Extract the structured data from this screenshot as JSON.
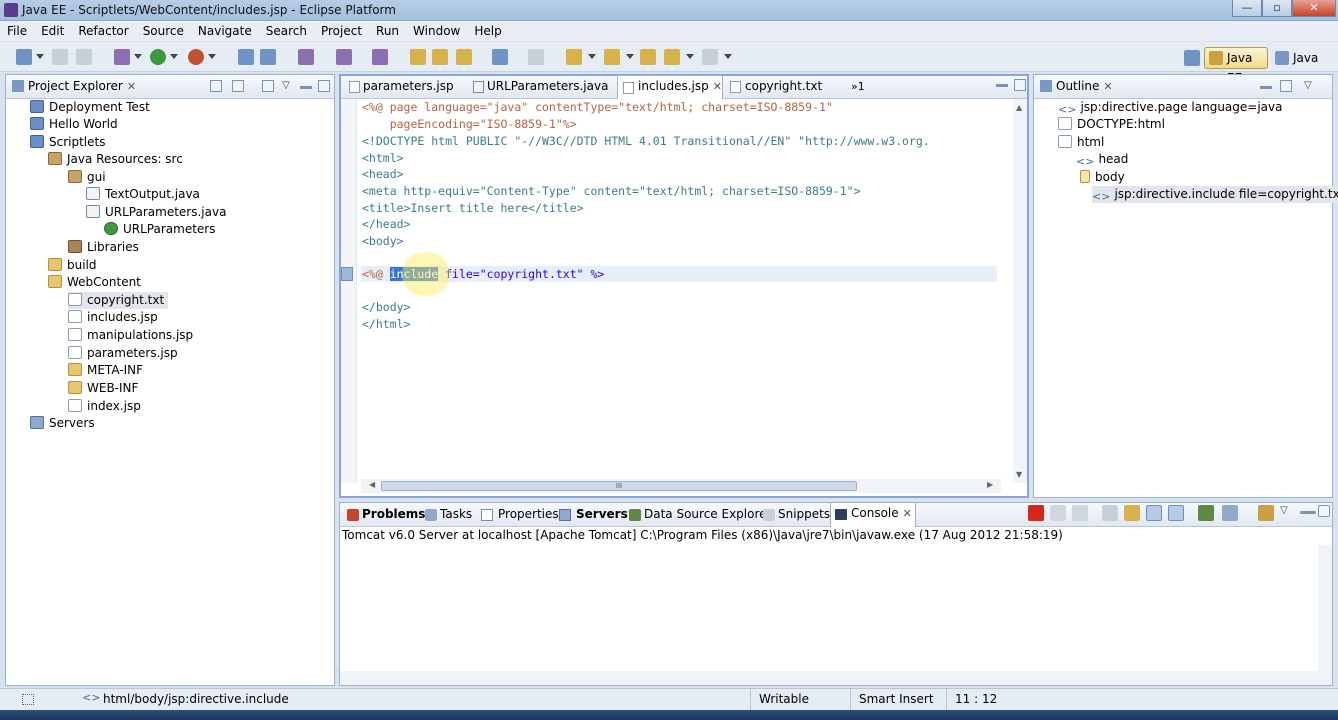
{
  "window": {
    "title": "Java EE - Scriptlets/WebContent/includes.jsp - Eclipse Platform",
    "min": "—",
    "max": "▫",
    "close": "✕"
  },
  "menu": [
    "File",
    "Edit",
    "Refactor",
    "Source",
    "Navigate",
    "Search",
    "Project",
    "Run",
    "Window",
    "Help"
  ],
  "perspectives": {
    "active": "Java EE",
    "other": "Java"
  },
  "project_explorer": {
    "title": "Project Explorer",
    "items": [
      {
        "label": "Deployment Test",
        "icon": "project-icon",
        "depth": 0
      },
      {
        "label": "Hello World",
        "icon": "project-icon",
        "depth": 0
      },
      {
        "label": "Scriptlets",
        "icon": "project-icon",
        "depth": 0
      },
      {
        "label": "Java Resources: src",
        "icon": "source-folder-icon",
        "depth": 1
      },
      {
        "label": "gui",
        "icon": "package-icon",
        "depth": 2
      },
      {
        "label": "TextOutput.java",
        "icon": "java-file-icon",
        "depth": 3
      },
      {
        "label": "URLParameters.java",
        "icon": "java-file-icon",
        "depth": 3
      },
      {
        "label": "URLParameters",
        "icon": "class-icon",
        "depth": 4
      },
      {
        "label": "Libraries",
        "icon": "libraries-icon",
        "depth": 2
      },
      {
        "label": "build",
        "icon": "folder-icon",
        "depth": 1
      },
      {
        "label": "WebContent",
        "icon": "folder-icon",
        "depth": 1
      },
      {
        "label": "copyright.txt",
        "icon": "text-file-icon",
        "depth": 2
      },
      {
        "label": "includes.jsp",
        "icon": "jsp-file-icon",
        "depth": 2
      },
      {
        "label": "manipulations.jsp",
        "icon": "jsp-file-icon",
        "depth": 2
      },
      {
        "label": "parameters.jsp",
        "icon": "jsp-file-icon",
        "depth": 2
      },
      {
        "label": "META-INF",
        "icon": "folder-icon",
        "depth": 2
      },
      {
        "label": "WEB-INF",
        "icon": "folder-icon",
        "depth": 2
      },
      {
        "label": "index.jsp",
        "icon": "jsp-file-icon",
        "depth": 2
      },
      {
        "label": "Servers",
        "icon": "servers-icon",
        "depth": 0
      }
    ]
  },
  "editor": {
    "tabs": [
      "parameters.jsp",
      "URLParameters.java",
      "includes.jsp",
      "copyright.txt"
    ],
    "active_tab": "includes.jsp",
    "overflow": "»1",
    "lines": {
      "l1": "<%@ page language=\"java\" contentType=\"text/html; charset=ISO-8859-1\"",
      "l2": "    pageEncoding=\"ISO-8859-1\"%>",
      "l3": "<!DOCTYPE html PUBLIC \"-//W3C//DTD HTML 4.01 Transitional//EN\" \"http://www.w3.org.",
      "l4": "<html>",
      "l5": "<head>",
      "l6": "<meta http-equiv=\"Content-Type\" content=\"text/html; charset=ISO-8859-1\">",
      "l7": "<title>Insert title here</title>",
      "l8": "</head>",
      "l9": "<body>",
      "l11a": "<%@ ",
      "l11sel": "include",
      "l11b": " file=\"copyright.txt\" %>",
      "l13": "</body>",
      "l14": "</html>"
    },
    "scroll_marker": "III"
  },
  "outline": {
    "title": "Outline",
    "items": [
      {
        "label": "jsp:directive.page language=java",
        "icon": "tag-icon",
        "depth": 0
      },
      {
        "label": "DOCTYPE:html",
        "icon": "doctype-icon",
        "depth": 0
      },
      {
        "label": "html",
        "icon": "element-icon",
        "depth": 0
      },
      {
        "label": "head",
        "icon": "tag-icon",
        "depth": 1
      },
      {
        "label": "body",
        "icon": "element-icon",
        "depth": 1
      },
      {
        "label": "jsp:directive.include file=copyright.txt",
        "icon": "tag-icon",
        "depth": 2
      }
    ]
  },
  "bottom": {
    "tabs": [
      "Problems",
      "Tasks",
      "Properties",
      "Servers",
      "Data Source Explorer",
      "Snippets",
      "Console"
    ],
    "active_tab": "Console",
    "console_header": "Tomcat v6.0 Server at localhost [Apache Tomcat] C:\\Program Files (x86)\\Java\\jre7\\bin\\javaw.exe (17 Aug 2012 21:58:19)"
  },
  "status": {
    "path": "html/body/jsp:directive.include",
    "writable": "Writable",
    "insert_mode": "Smart Insert",
    "position": "11 : 12"
  },
  "colors": {
    "accent": "#3875d7",
    "keyword": "#7f3f00",
    "attribute": "#7f007f",
    "value": "#2a00ff"
  }
}
